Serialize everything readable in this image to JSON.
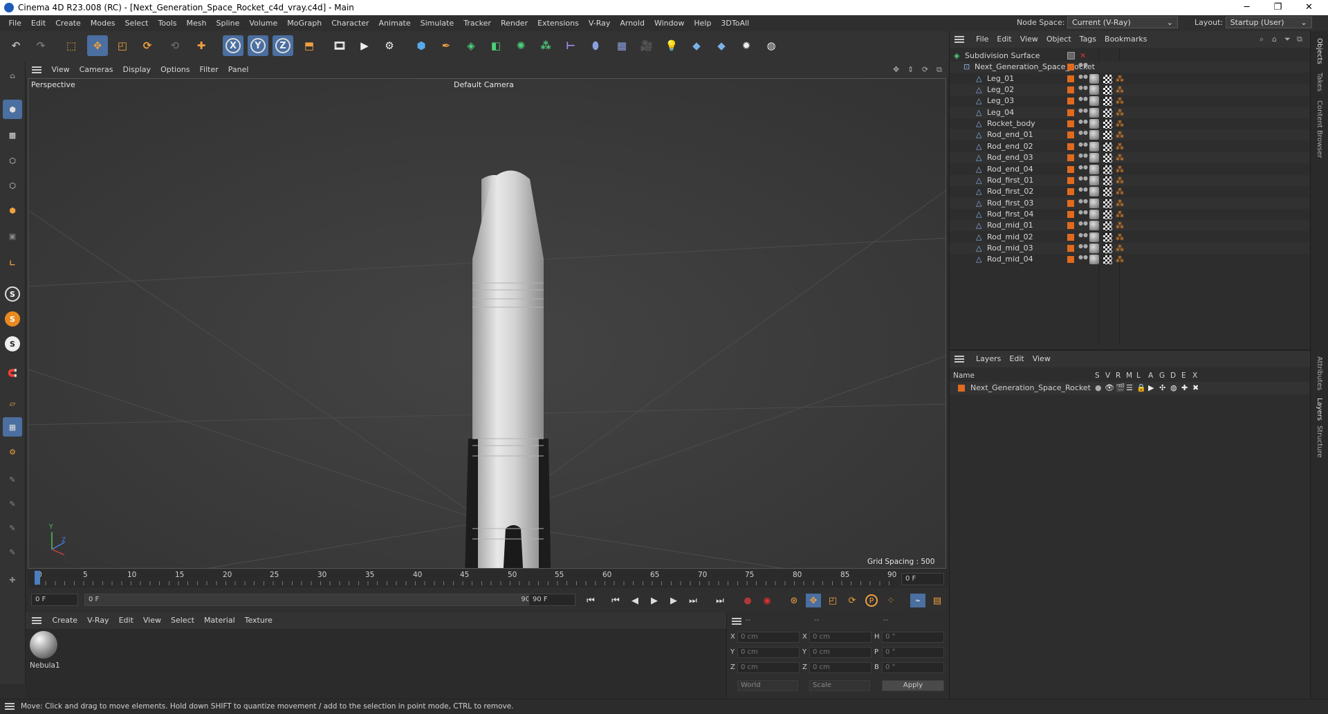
{
  "window": {
    "title": "Cinema 4D R23.008 (RC) - [Next_Generation_Space_Rocket_c4d_vray.c4d] - Main",
    "minimize": "─",
    "maximize": "❐",
    "close": "✕"
  },
  "menubar": {
    "items": [
      "File",
      "Edit",
      "Create",
      "Modes",
      "Select",
      "Tools",
      "Mesh",
      "Spline",
      "Volume",
      "MoGraph",
      "Character",
      "Animate",
      "Simulate",
      "Tracker",
      "Render",
      "Extensions",
      "V-Ray",
      "Arnold",
      "Window",
      "Help",
      "3DToAll"
    ],
    "node_space_label": "Node Space:",
    "node_space_value": "Current (V-Ray)",
    "layout_label": "Layout:",
    "layout_value": "Startup (User)"
  },
  "toolbar": {
    "axis_x": "X",
    "axis_y": "Y",
    "axis_z": "Z",
    "icons": [
      "undo-icon",
      "redo-icon",
      "live-selection-icon",
      "move-icon",
      "scale-icon",
      "rotate-icon",
      "last-tool-icon",
      "add-icon",
      "axis-x-icon",
      "axis-y-icon",
      "axis-z-icon",
      "coordinate-system-icon",
      "render-region-icon",
      "render-view-icon",
      "render-settings-icon",
      "cube-icon",
      "pen-icon",
      "subdivision-icon",
      "extrude-icon",
      "cloner-icon",
      "array-icon",
      "deformer-icon",
      "field-icon",
      "floor-icon",
      "camera-icon",
      "light-icon",
      "python-icon",
      "python-icon-2",
      "gear-icon",
      "globe-icon"
    ]
  },
  "lefttools": {
    "s1": "S",
    "s2": "S",
    "s3": "S"
  },
  "viewport": {
    "menu": [
      "View",
      "Cameras",
      "Display",
      "Options",
      "Filter",
      "Panel"
    ],
    "view_name": "Perspective",
    "camera_name": "Default Camera",
    "grid_spacing": "Grid Spacing : 500 cm",
    "axis_y": "Y",
    "axis_z": "Z"
  },
  "timeline": {
    "ticks": [
      "0",
      "5",
      "10",
      "15",
      "20",
      "25",
      "30",
      "35",
      "40",
      "45",
      "50",
      "55",
      "60",
      "65",
      "70",
      "75",
      "80",
      "85",
      "90"
    ],
    "current_frame": "0 F"
  },
  "transport": {
    "start_field": "0 F",
    "range_start": "0 F",
    "range_end": "90 F",
    "end_field": "90 F",
    "keyframe_p": "P"
  },
  "material_manager": {
    "menu": [
      "Create",
      "V-Ray",
      "Edit",
      "View",
      "Select",
      "Material",
      "Texture"
    ],
    "materials": [
      {
        "name": "Nebula1"
      }
    ]
  },
  "coordinates": {
    "header_a": "--",
    "header_b": "--",
    "header_c": "--",
    "rows": [
      {
        "a_label": "X",
        "a_val": "0 cm",
        "b_label": "X",
        "b_val": "0 cm",
        "c_label": "H",
        "c_val": "0 °"
      },
      {
        "a_label": "Y",
        "a_val": "0 cm",
        "b_label": "Y",
        "b_val": "0 cm",
        "c_label": "P",
        "c_val": "0 °"
      },
      {
        "a_label": "Z",
        "a_val": "0 cm",
        "b_label": "Z",
        "b_val": "0 cm",
        "c_label": "B",
        "c_val": "0 °"
      }
    ],
    "space": "World",
    "mode": "Scale",
    "apply": "Apply"
  },
  "object_manager": {
    "menu": [
      "File",
      "Edit",
      "View",
      "Object",
      "Tags",
      "Bookmarks"
    ],
    "root": "Subdivision Surface",
    "group": "Next_Generation_Space_Rocket",
    "children": [
      "Leg_01",
      "Leg_02",
      "Leg_03",
      "Leg_04",
      "Rocket_body",
      "Rod_end_01",
      "Rod_end_02",
      "Rod_end_03",
      "Rod_end_04",
      "Rod_first_01",
      "Rod_first_02",
      "Rod_first_03",
      "Rod_first_04",
      "Rod_mid_01",
      "Rod_mid_02",
      "Rod_mid_03",
      "Rod_mid_04"
    ],
    "layer_color": "#e06a1e"
  },
  "layer_manager": {
    "menu": [
      "Layers",
      "Edit",
      "View"
    ],
    "col_name": "Name",
    "cols": [
      "S",
      "V",
      "R",
      "M",
      "L",
      "A",
      "G",
      "D",
      "E",
      "X"
    ],
    "layers": [
      {
        "name": "Next_Generation_Space_Rocket"
      }
    ]
  },
  "right_tabs": [
    "Objects",
    "Takes",
    "Content Browser",
    "Attributes",
    "Layers",
    "Structure"
  ],
  "status": "Move: Click and drag to move elements. Hold down SHIFT to quantize movement / add to the selection in point mode, CTRL to remove."
}
